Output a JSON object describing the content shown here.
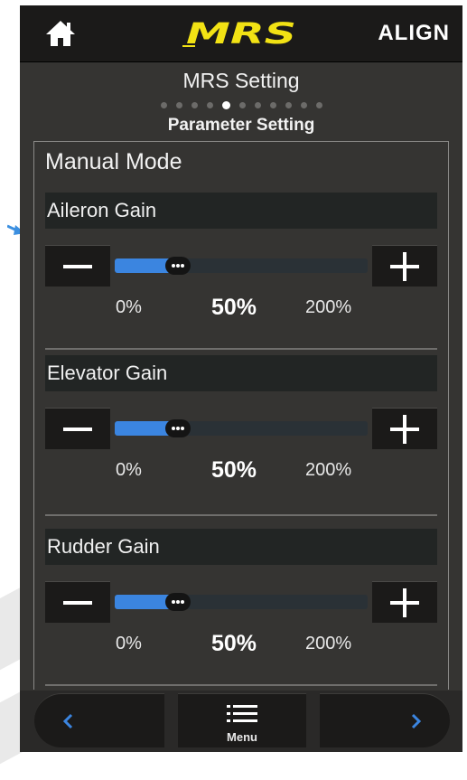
{
  "header": {
    "brand_logo": "MRS",
    "align_logo": "ALIGN",
    "home_icon": "home-icon"
  },
  "page": {
    "title": "MRS Setting",
    "subtitle": "Parameter Setting",
    "pager": {
      "count": 11,
      "active_index": 4
    }
  },
  "section": {
    "title": "Manual Mode",
    "gains": [
      {
        "label": "Aileron Gain",
        "min_label": "0%",
        "value_label": "50%",
        "max_label": "200%",
        "value_fraction": 0.25
      },
      {
        "label": "Elevator Gain",
        "min_label": "0%",
        "value_label": "50%",
        "max_label": "200%",
        "value_fraction": 0.25
      },
      {
        "label": "Rudder Gain",
        "min_label": "0%",
        "value_label": "50%",
        "max_label": "200%",
        "value_fraction": 0.25
      }
    ]
  },
  "bottom_nav": {
    "prev_icon": "chevron-left-icon",
    "menu_icon": "menu-icon",
    "menu_label": "Menu",
    "next_icon": "chevron-right-icon"
  },
  "colors": {
    "accent": "#3b85e0",
    "brand_yellow": "#f2e214",
    "background": "#353432",
    "bar": "#1b1a19"
  }
}
